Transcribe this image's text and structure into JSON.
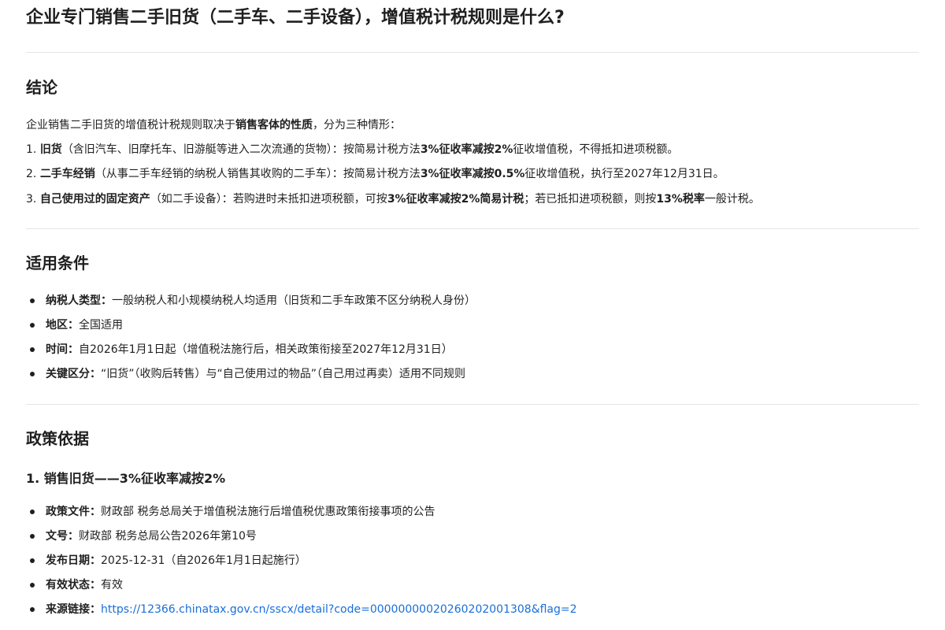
{
  "title": "企业专门销售二手旧货（二手车、二手设备），增值税计税规则是什么?",
  "conclusion": {
    "heading": "结论",
    "intro": {
      "prefix": "企业销售二手旧货的增值税计税规则取决于",
      "bold": "销售客体的性质",
      "suffix": "，分为三种情形："
    },
    "items": [
      {
        "num": "1. ",
        "bold_label": "旧货",
        "paren": "（含旧汽车、旧摩托车、旧游艇等进入二次流通的货物）：",
        "t1": "按简易计税方法",
        "b1": "3%征收率减按2%",
        "t2": "征收增值税，不得抵扣进项税额。"
      },
      {
        "num": "2. ",
        "bold_label": "二手车经销",
        "paren": "（从事二手车经销的纳税人销售其收购的二手车）：",
        "t1": "按简易计税方法",
        "b1": "3%征收率减按0.5%",
        "t2": "征收增值税，执行至2027年12月31日。"
      },
      {
        "num": "3. ",
        "bold_label": "自己使用过的固定资产",
        "paren": "（如二手设备）：",
        "t1": "若购进时未抵扣进项税额，可按",
        "b1": "3%征收率减按2%简易计税",
        "t2": "；若已抵扣进项税额，则按",
        "b2": "13%税率",
        "t3": "一般计税。"
      }
    ]
  },
  "conditions": {
    "heading": "适用条件",
    "items": [
      {
        "label": "纳税人类型：",
        "text": "一般纳税人和小规模纳税人均适用（旧货和二手车政策不区分纳税人身份）"
      },
      {
        "label": "地区：",
        "text": "全国适用"
      },
      {
        "label": "时间：",
        "text": "自2026年1月1日起（增值税法施行后，相关政策衔接至2027年12月31日）"
      },
      {
        "label": "关键区分：",
        "text": "“旧货”（收购后转售）与“自己使用过的物品”（自己用过再卖）适用不同规则"
      }
    ]
  },
  "basis": {
    "heading": "政策依据",
    "subheading": "1. 销售旧货——3%征收率减按2%",
    "items": [
      {
        "label": "政策文件：",
        "text": "财政部 税务总局关于增值税法施行后增值税优惠政策衔接事项的公告"
      },
      {
        "label": "文号：",
        "text": "财政部 税务总局公告2026年第10号"
      },
      {
        "label": "发布日期：",
        "text": "2025-12-31（自2026年1月1日起施行）"
      },
      {
        "label": "有效状态：",
        "text": "有效"
      },
      {
        "label": "来源链接：",
        "link": "https://12366.chinatax.gov.cn/sscx/detail?code=00000000020260202001308&flag=2"
      }
    ]
  },
  "colors": {
    "text": "#1f1f1f",
    "link": "#1a6ed8",
    "divider": "#e6e6e6"
  }
}
